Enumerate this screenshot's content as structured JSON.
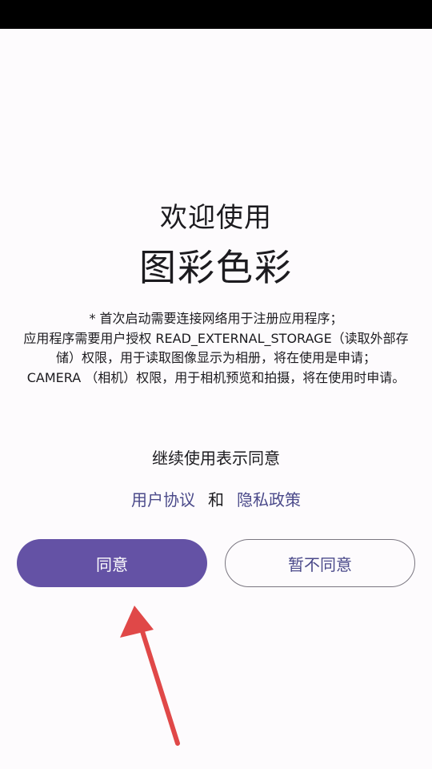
{
  "dialog": {
    "welcome": "欢迎使用",
    "app_name": "图彩色彩",
    "notice_lines": [
      "* 首次启动需要连接网络用于注册应用程序；",
      "应用程序需要用户授权 READ_EXTERNAL_STORAGE（读取外部存储）权限，用于读取图像显示为相册，将在使用是申请；",
      "CAMERA （相机）权限，用于相机预览和拍摄，将在使用时申请。"
    ],
    "continue_text": "继续使用表示同意",
    "user_agreement_link": "用户协议",
    "and_text": "和",
    "privacy_policy_link": "隐私政策",
    "agree_button": "同意",
    "disagree_button": "暂不同意"
  },
  "colors": {
    "primary": "#6452a5",
    "link": "#4b4a8a",
    "annotation_arrow": "#e04848"
  },
  "annotation": {
    "icon": "red-arrow-icon"
  }
}
